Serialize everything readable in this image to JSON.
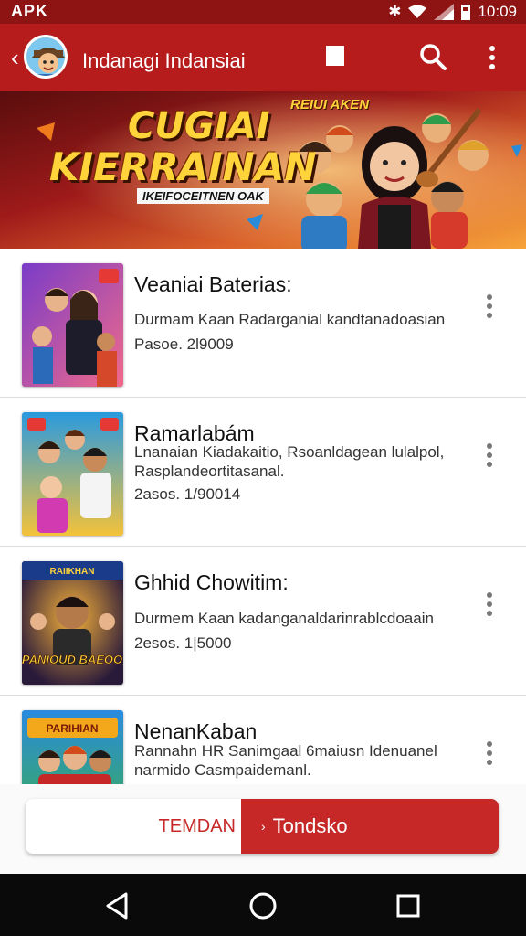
{
  "status_bar": {
    "left_label": "APK",
    "time": "10:09"
  },
  "toolbar": {
    "title": "Indanagi Indansiai",
    "icons": [
      "back-arrow",
      "app-avatar",
      "square-stop",
      "search",
      "more-vertical"
    ]
  },
  "banner": {
    "title_line1": "CUGIAI",
    "title_line2": "KIERRAINAN",
    "subtitle": "IKEIFOCEITNEN OAK",
    "badge": "REIUI AKEN"
  },
  "items": [
    {
      "title": "Veaniai Baterias:",
      "description": "Durmam Kaan Radarganial kandtanadoasian",
      "meta": "Pasoe. 2l9009"
    },
    {
      "title": "Ramarlabám",
      "description": "Lnanaian Kiadakaitio, Rsoanldagean lulalpol, Rasplandeortitasanal.",
      "meta": "2asos. 1/90014"
    },
    {
      "title": "Ghhid Chowitim:",
      "description": "Durmem Kaan kadanganaldarinrablcdoaain",
      "meta": "2esos. 1|5000",
      "thumb_label_top": "RAIIKHAN",
      "thumb_label_bottom": "PANIOUD BAEOO"
    },
    {
      "title": "NenanKaban",
      "description": "Rannahn HR Sanimgaal 6maiusn Idenuanel narmido Casmpaidemanl.",
      "meta": "",
      "thumb_label_top": "PARIHIAN"
    }
  ],
  "thumb_labels": {
    "item2_top": "RAIIKHAN",
    "item2_bottom": "PANIOUD BAEOO",
    "item3_top": "PARIHIAN"
  },
  "actions": {
    "secondary_label": "TEMDAN",
    "primary_label": "Tondsko",
    "primary_icon": "arrow-small"
  },
  "nav_bar": {
    "icons": [
      "back-triangle",
      "home-circle",
      "recents-square"
    ]
  },
  "colors": {
    "primary": "#b71c1c",
    "status": "#8e1414",
    "accent": "#c62828",
    "nav": "#0a0a0a"
  }
}
